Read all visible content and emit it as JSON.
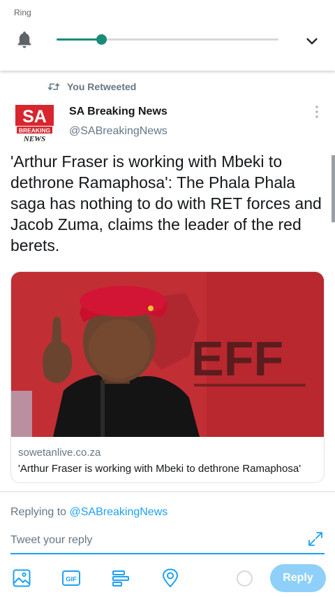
{
  "volume_panel": {
    "label": "Ring",
    "level": 0.2,
    "icon": "bell-icon",
    "expand_icon": "chevron-down-icon",
    "accent_color": "#1a8b7a"
  },
  "tweet": {
    "context": "You Retweeted",
    "author": {
      "name": "SA Breaking News",
      "handle": "@SABreakingNews",
      "avatar_text": [
        "SA",
        "BREAKING",
        "NEWS"
      ]
    },
    "text": "'Arthur Fraser is working with Mbeki to dethrone Ramaphosa': The Phala Phala saga has nothing to do with RET forces and Jacob Zuma, claims the leader of the red berets.",
    "card": {
      "domain": "sowetanlive.co.za",
      "title": "'Arthur Fraser is working with Mbeki to dethrone Ramaphosa'",
      "image_text": "EFF"
    }
  },
  "composer": {
    "replying_prefix": "Replying to",
    "replying_handle": "@SABreakingNews",
    "placeholder": "Tweet your reply",
    "value": "",
    "tools": [
      "image-icon",
      "gif-icon",
      "poll-icon",
      "location-icon"
    ],
    "gif_label": "GIF",
    "reply_label": "Reply",
    "accent_color": "#1da1f2"
  }
}
